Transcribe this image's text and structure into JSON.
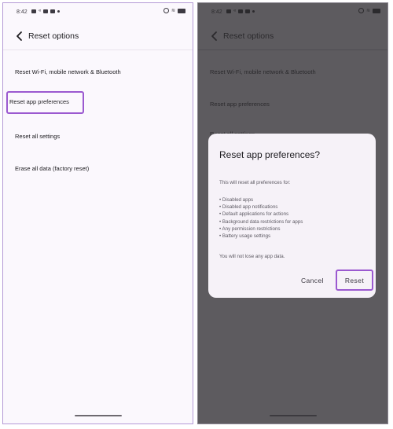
{
  "status_bar": {
    "time": "8:42",
    "left_icons": [
      "linkedin-icon",
      "signal-icon",
      "mail-icon",
      "mail-icon",
      "dot-icon"
    ],
    "right_icons": [
      "alarm-icon",
      "wifi-icon",
      "battery-icon"
    ]
  },
  "screen_left": {
    "title": "Reset options",
    "items": [
      "Reset Wi-Fi, mobile network & Bluetooth",
      "Reset app preferences",
      "Reset all settings",
      "Erase all data (factory reset)"
    ],
    "highlighted_item": "Reset app preferences",
    "highlight_color": "#9b59d0"
  },
  "screen_right": {
    "title": "Reset options",
    "items": [
      "Reset Wi-Fi, mobile network & Bluetooth",
      "Reset app preferences",
      "Reset all settings"
    ],
    "dialog": {
      "title": "Reset app preferences?",
      "intro": "This will reset all preferences for:",
      "list": [
        "• Disabled apps",
        "• Disabled app notifications",
        "• Default applications for actions",
        "• Background data restrictions for apps",
        "• Any permission restrictions",
        "• Battery usage settings"
      ],
      "note": "You will not lose any app data.",
      "cancel_label": "Cancel",
      "reset_label": "Reset"
    }
  }
}
